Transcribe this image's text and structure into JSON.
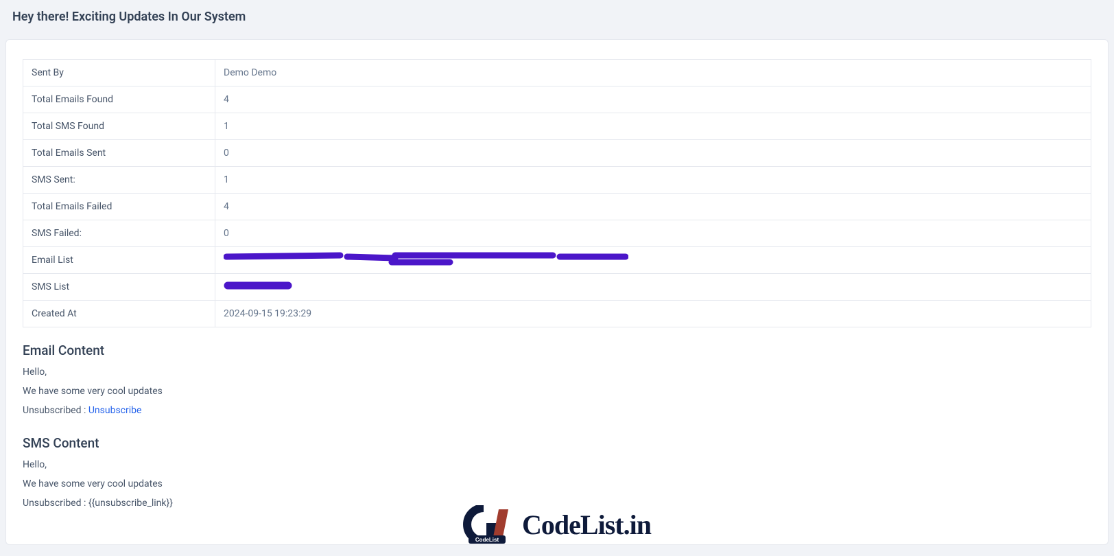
{
  "page_title": "Hey there! Exciting Updates In Our System",
  "details": {
    "sent_by_label": "Sent By",
    "sent_by_value": "Demo Demo",
    "total_emails_found_label": "Total Emails Found",
    "total_emails_found_value": "4",
    "total_sms_found_label": "Total SMS Found",
    "total_sms_found_value": "1",
    "total_emails_sent_label": "Total Emails Sent",
    "total_emails_sent_value": "0",
    "sms_sent_label": "SMS Sent:",
    "sms_sent_value": "1",
    "total_emails_failed_label": "Total Emails Failed",
    "total_emails_failed_value": "4",
    "sms_failed_label": "SMS Failed:",
    "sms_failed_value": "0",
    "email_list_label": "Email List",
    "sms_list_label": "SMS List",
    "created_at_label": "Created At",
    "created_at_value": "2024-09-15 19:23:29"
  },
  "email_content": {
    "heading": "Email Content",
    "greeting": "Hello,",
    "body": "We have some very cool updates",
    "unsub_prefix": "Unsubscribed : ",
    "unsub_link_text": "Unsubscribe"
  },
  "sms_content": {
    "heading": "SMS Content",
    "greeting": "Hello,",
    "body": "We have some very cool updates",
    "unsub_line": "Unsubscribed : {{unsubscribe_link}}"
  },
  "watermark": "CodeList.in"
}
